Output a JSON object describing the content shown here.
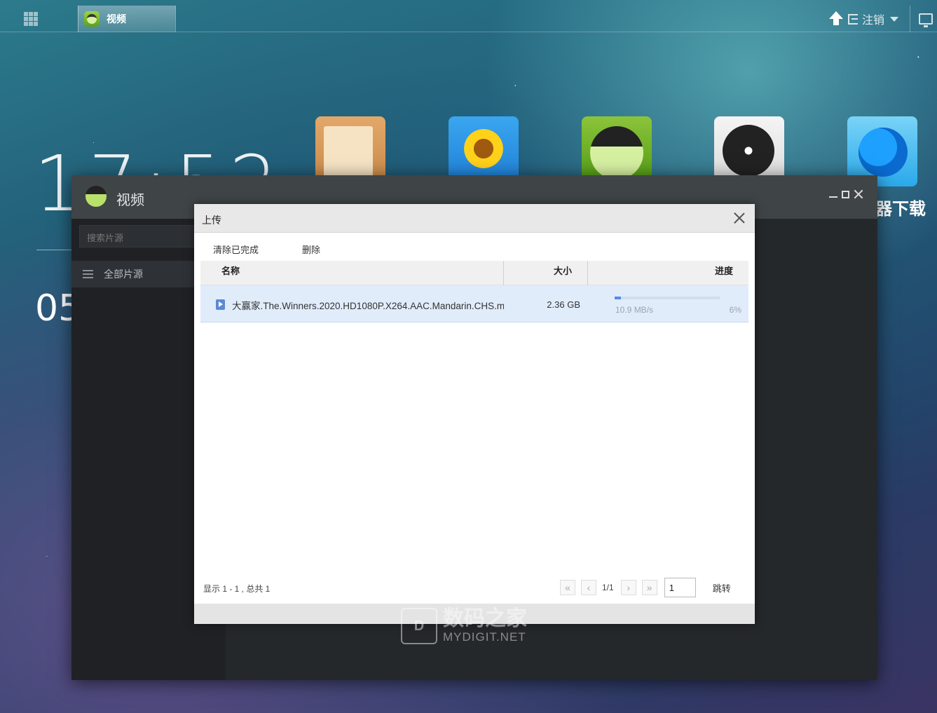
{
  "taskbar": {
    "active_app_label": "视频",
    "logout_label": "注销"
  },
  "desktop": {
    "clock_time": "17:52",
    "clock_date": "05",
    "icons": [
      "notes-icon",
      "photo-icon",
      "video-icon",
      "music-icon",
      "download-icon"
    ],
    "download_label_partial": "器下载"
  },
  "app_window": {
    "title": "视频",
    "search_placeholder": "搜索片源",
    "sidebar_items": [
      {
        "label": "全部片源"
      }
    ]
  },
  "upload_dialog": {
    "title": "上传",
    "toolbar": {
      "clear_completed": "清除已完成",
      "delete": "删除"
    },
    "columns": {
      "name": "名称",
      "size": "大小",
      "progress": "进度"
    },
    "rows": [
      {
        "name": "大赢家.The.Winners.2020.HD1080P.X264.AAC.Mandarin.CHS.m",
        "size": "2.36 GB",
        "speed": "10.9 MB/s",
        "progress_label": "6%",
        "progress_value": 0.06
      }
    ],
    "footer": {
      "count_text": "显示 1 - 1 , 总共 1",
      "page_info": "1/1",
      "page_input_value": "1",
      "go_label": "跳转"
    }
  },
  "watermark": {
    "brand_cn": "数码之家",
    "brand_en": "MYDIGIT.NET",
    "logo_text": "D"
  },
  "colors": {
    "accent": "#4d8fe8",
    "row_selected": "#e1ecfb",
    "app_dark": "#26292c"
  }
}
